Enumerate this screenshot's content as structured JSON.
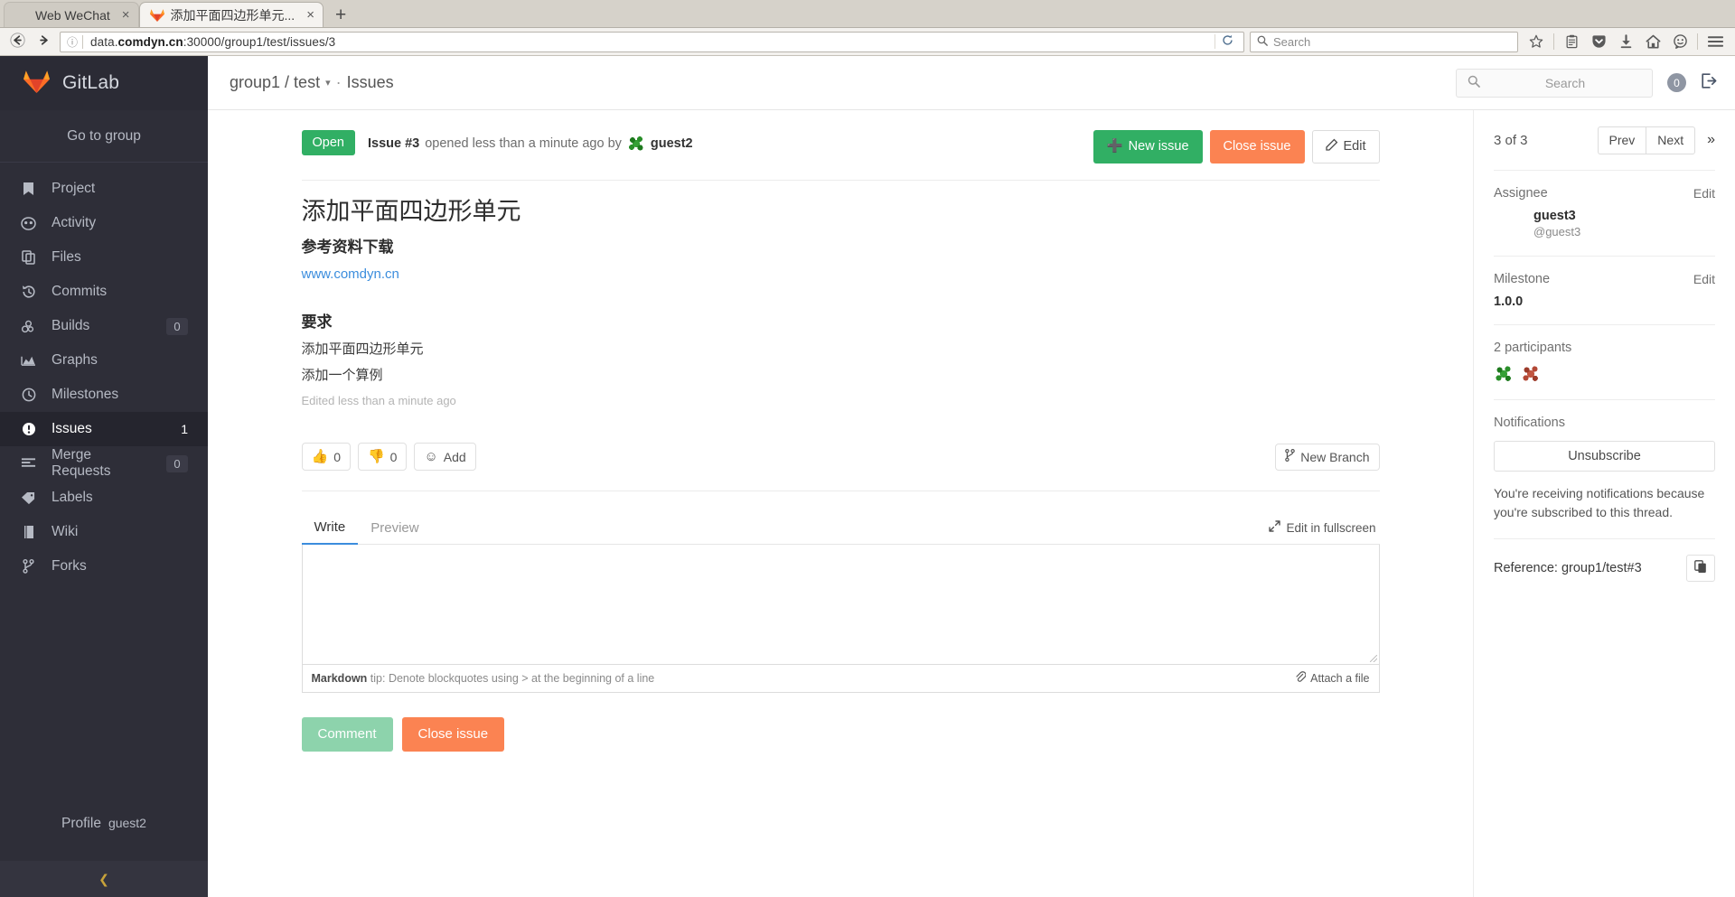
{
  "browser": {
    "tabs": [
      {
        "title": "Web WeChat",
        "favicon": "wechat-icon",
        "active": false
      },
      {
        "title": "添加平面四边形单元...",
        "favicon": "gitlab-icon",
        "active": true
      }
    ],
    "new_tab_label": "+",
    "close_label": "×",
    "url": {
      "prefix": "data.",
      "bold": "comdyn.cn",
      "suffix": ":30000/group1/test/issues/3"
    },
    "search_placeholder": "Search",
    "nav": {
      "back": "←",
      "forward": "→",
      "reload": "⟳",
      "info": "ⓘ"
    },
    "toolbar_icons": [
      "star-icon",
      "reading-list-icon",
      "pocket-icon",
      "download-icon",
      "home-icon",
      "sync-chat-icon",
      "hamburger-menu-icon"
    ]
  },
  "sidebar": {
    "brand": "GitLab",
    "go_to_group": "Go to group",
    "items": [
      {
        "label": "Project",
        "icon": "bookmark-icon",
        "badge": null,
        "count": null,
        "active": false
      },
      {
        "label": "Activity",
        "icon": "activity-icon",
        "badge": null,
        "count": null,
        "active": false
      },
      {
        "label": "Files",
        "icon": "files-icon",
        "badge": null,
        "count": null,
        "active": false
      },
      {
        "label": "Commits",
        "icon": "history-icon",
        "badge": null,
        "count": null,
        "active": false
      },
      {
        "label": "Builds",
        "icon": "builds-icon",
        "badge": "0",
        "count": null,
        "active": false
      },
      {
        "label": "Graphs",
        "icon": "chart-area-icon",
        "badge": null,
        "count": null,
        "active": false
      },
      {
        "label": "Milestones",
        "icon": "clock-icon",
        "badge": null,
        "count": null,
        "active": false
      },
      {
        "label": "Issues",
        "icon": "exclamation-circle-icon",
        "badge": null,
        "count": "1",
        "active": true
      },
      {
        "label": "Merge Requests",
        "icon": "merge-request-icon",
        "badge": "0",
        "count": null,
        "active": false
      },
      {
        "label": "Labels",
        "icon": "tag-icon",
        "badge": null,
        "count": null,
        "active": false
      },
      {
        "label": "Wiki",
        "icon": "book-icon",
        "badge": null,
        "count": null,
        "active": false
      },
      {
        "label": "Forks",
        "icon": "fork-icon",
        "badge": null,
        "count": null,
        "active": false
      }
    ],
    "profile_label": "Profile",
    "profile_user": "guest2",
    "collapse_icon": "chevron-left-icon"
  },
  "topbar": {
    "breadcrumb_group": "group1 / test",
    "breadcrumb_sep": "·",
    "breadcrumb_page": "Issues",
    "search_placeholder": "Search",
    "todo_count": "0",
    "signout_icon": "sign-out-icon"
  },
  "issue": {
    "state_badge": "Open",
    "number": "Issue #3",
    "opened_text": "opened less than a minute ago by",
    "author": "guest2",
    "actions": {
      "new_issue": "New issue",
      "close_issue": "Close issue",
      "edit": "Edit"
    },
    "title": "添加平面四边形单元",
    "description": {
      "heading1": "参考资料下载",
      "link": "www.comdyn.cn",
      "heading2": "要求",
      "line1": "添加平面四边形单元",
      "line2": "添加一个算例",
      "edited": "Edited less than a minute ago"
    },
    "awards": {
      "thumbs_up": "0",
      "thumbs_down": "0",
      "add_label": "Add"
    },
    "new_branch": "New Branch"
  },
  "comment_form": {
    "tabs": [
      {
        "label": "Write",
        "selected": true
      },
      {
        "label": "Preview",
        "selected": false
      }
    ],
    "fullscreen_label": "Edit in fullscreen",
    "textarea_value": "",
    "textarea_placeholder": "",
    "markdown_tip_bold": "Markdown",
    "markdown_tip_rest": "tip: Denote blockquotes using > at the beginning of a line",
    "attach_label": "Attach a file",
    "submit_label": "Comment",
    "close_label": "Close issue"
  },
  "rightbar": {
    "position": "3 of 3",
    "prev": "Prev",
    "next": "Next",
    "expand_icon": "chevron-double-right-icon",
    "assignee": {
      "title": "Assignee",
      "edit": "Edit",
      "name": "guest3",
      "handle": "@guest3"
    },
    "milestone": {
      "title": "Milestone",
      "edit": "Edit",
      "value": "1.0.0"
    },
    "participants": {
      "title": "2 participants",
      "count": 2
    },
    "notifications": {
      "title": "Notifications",
      "button": "Unsubscribe",
      "note": "You're receiving notifications because you're subscribed to this thread."
    },
    "reference": {
      "text": "Reference: group1/test#3",
      "copy_icon": "copy-icon"
    }
  },
  "colors": {
    "gitlab_dark": "#2e2e38",
    "green": "#31af64",
    "orange": "#fb8352",
    "link": "#3b8ddd",
    "tab_bar": "#d6d2ca"
  }
}
